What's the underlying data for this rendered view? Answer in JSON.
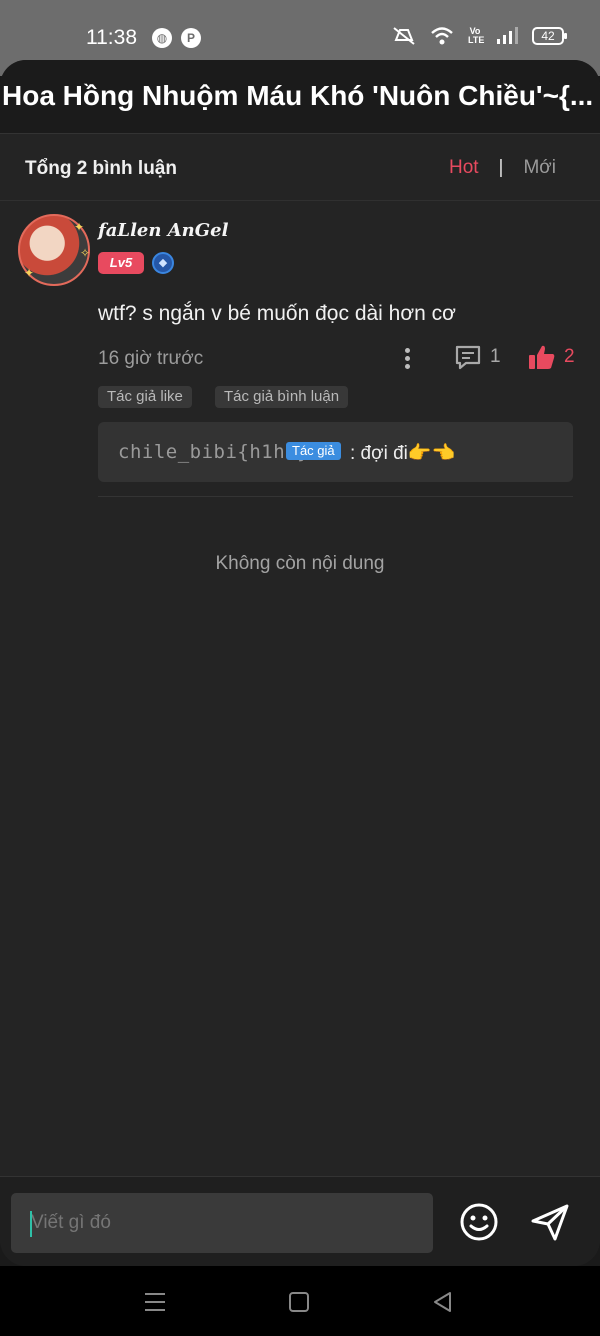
{
  "status_bar": {
    "time": "11:38",
    "battery": "42",
    "network_label": "Vo LTE"
  },
  "header": {
    "title": "Hoa Hồng Nhuộm Máu Khó 'Nuôn Chiều'~{..."
  },
  "comments_header": {
    "total": "Tổng 2 bình luận",
    "sort_hot": "Hot",
    "separator": "|",
    "sort_new": "Mới"
  },
  "comment": {
    "username": "faLlen AnGel",
    "level": "Lv5",
    "text": "wtf? s ngắn v bé muốn đọc dài hơn cơ",
    "time": "16 giờ trước",
    "reply_count": "1",
    "like_count": "2",
    "tags": [
      "Tác giả like",
      "Tác giả bình luận"
    ],
    "reply": {
      "username": "chile_bibi{h1h4}",
      "author_badge": "Tác giả",
      "text": ": đợi đi👉👈"
    }
  },
  "end_note": "Không còn nội dung",
  "input": {
    "placeholder": "Viết gì đó"
  },
  "colors": {
    "accent": "#e84a5f",
    "author_badge": "#3b8de0",
    "background": "#242424"
  }
}
